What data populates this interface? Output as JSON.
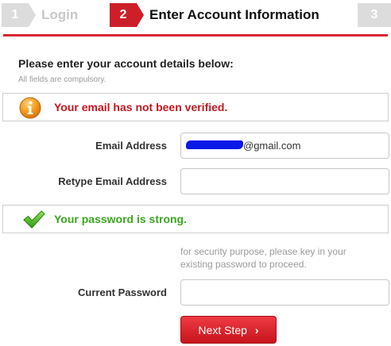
{
  "steps": [
    {
      "number": "1",
      "label": "Login"
    },
    {
      "number": "2",
      "label": "Enter Account Information"
    },
    {
      "number": "3",
      "label": ""
    }
  ],
  "form": {
    "heading": "Please enter your account details below:",
    "subnote": "All fields are compulsory.",
    "email_alert": "Your email has not been verified.",
    "email_label": "Email Address",
    "email_value": "@gmail.com",
    "retype_label": "Retype Email Address",
    "retype_value": "",
    "password_alert": "Your password is strong.",
    "security_hint": "for security purpose, please key in your existing password to proceed.",
    "current_password_label": "Current Password",
    "current_password_value": "",
    "next_button": "Next Step",
    "next_icon": "›"
  },
  "icons": {
    "info": "info-icon",
    "check": "checkmark-icon"
  },
  "colors": {
    "accent": "#cd1f28",
    "error_text": "#c4161f",
    "success_text": "#3aa61f",
    "step_inactive": "#dcdcdc",
    "redaction": "#0a18e8"
  }
}
